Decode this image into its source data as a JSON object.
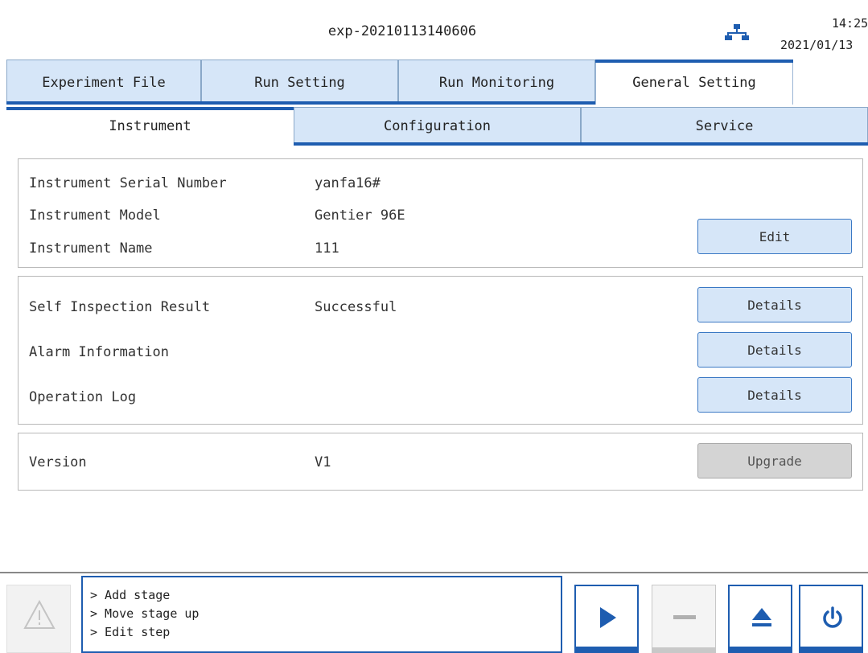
{
  "header": {
    "title": "exp-20210113140606",
    "time": "14:25",
    "date": "2021/01/13"
  },
  "main_tabs": [
    {
      "label": "Experiment File",
      "active": false
    },
    {
      "label": "Run Setting",
      "active": false
    },
    {
      "label": "Run Monitoring",
      "active": false
    },
    {
      "label": "General Setting",
      "active": true
    }
  ],
  "sub_tabs": [
    {
      "label": "Instrument",
      "active": true
    },
    {
      "label": "Configuration",
      "active": false
    },
    {
      "label": "Service",
      "active": false
    }
  ],
  "instrument_info": {
    "serial_label": "Instrument Serial Number",
    "serial_value": "yanfa16#",
    "model_label": "Instrument Model",
    "model_value": "Gentier 96E",
    "name_label": "Instrument Name",
    "name_value": "111",
    "edit_label": "Edit"
  },
  "diagnostics": {
    "self_inspection_label": "Self Inspection Result",
    "self_inspection_value": "Successful",
    "alarm_label": "Alarm Information",
    "log_label": "Operation Log",
    "details_label": "Details"
  },
  "version": {
    "label": "Version",
    "value": "V1",
    "upgrade_label": "Upgrade"
  },
  "console": {
    "lines": [
      "> Add stage",
      "> Move stage up",
      "> Edit step"
    ]
  },
  "controls": [
    {
      "icon": "play-icon",
      "enabled": true
    },
    {
      "icon": "stop-icon",
      "enabled": false
    },
    {
      "icon": "eject-icon",
      "enabled": true
    },
    {
      "icon": "power-icon",
      "enabled": true
    }
  ],
  "colors": {
    "accent": "#1e5db0",
    "tab_bg": "#d6e6f8",
    "disabled": "#d4d4d4"
  }
}
